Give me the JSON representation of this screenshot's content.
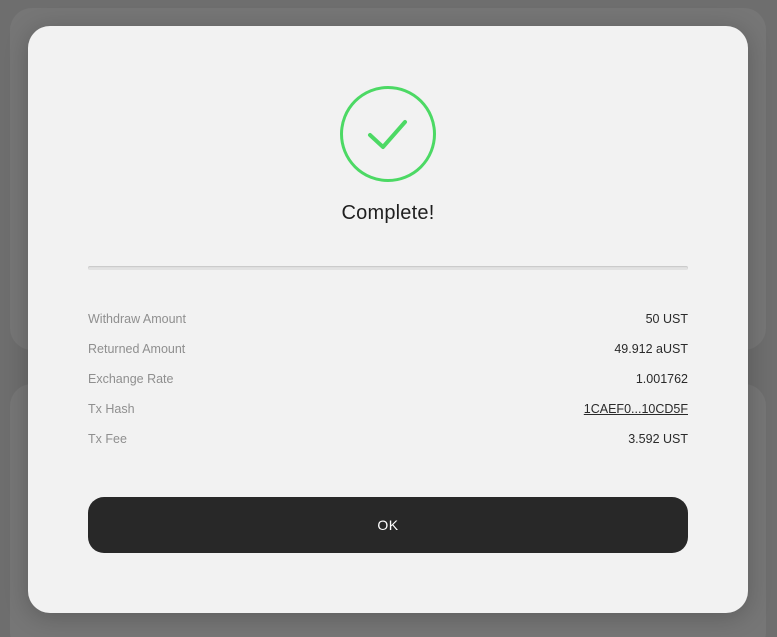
{
  "modal": {
    "status_icon": "check-circle-icon",
    "success_color": "#4cd964",
    "title": "Complete!",
    "details": [
      {
        "label": "Withdraw Amount",
        "value": "50 UST"
      },
      {
        "label": "Returned Amount",
        "value": "49.912 aUST"
      },
      {
        "label": "Exchange Rate",
        "value": "1.001762"
      },
      {
        "label": "Tx Hash",
        "value": "1CAEF0...10CD5F"
      },
      {
        "label": "Tx Fee",
        "value": "3.592 UST"
      }
    ],
    "ok_label": "OK"
  }
}
